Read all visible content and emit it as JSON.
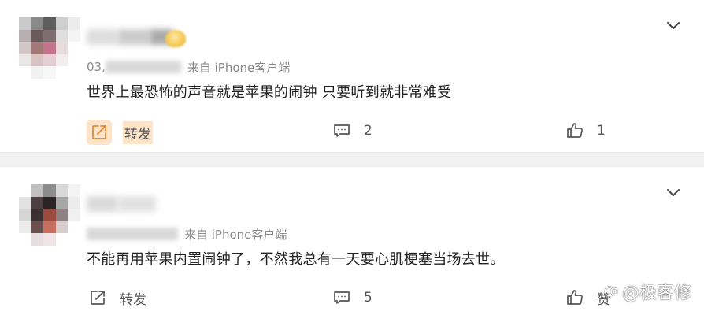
{
  "comments": [
    {
      "meta_date_partial": "03,",
      "source": "来自 iPhone客户端",
      "text": "世界上最恐怖的声音就是苹果的闹钟 只要听到就非常难受",
      "repost_label": "转发",
      "comment_count": "2",
      "like_count": "1",
      "repost_highlighted": true
    },
    {
      "meta_date_partial": "",
      "source": "来自 iPhone客户端",
      "text": "不能再用苹果内置闹钟了，不然我总有一天要心肌梗塞当场去世。",
      "repost_label": "转发",
      "comment_count": "5",
      "like_count": "赞",
      "repost_highlighted": false
    }
  ],
  "watermark": {
    "text": "@极客修"
  },
  "icons": {
    "expand": "chevron-down-icon",
    "repost": "share-arrow-icon",
    "comment": "comment-bubble-icon",
    "like": "thumbs-up-icon",
    "watermark": "app-logo-icon"
  },
  "colors": {
    "background": "#ffffff",
    "separator": "#f2f2f2",
    "text": "#222222",
    "meta": "#888888",
    "repost_highlight": "#fde3c8",
    "icon": "#555555"
  }
}
